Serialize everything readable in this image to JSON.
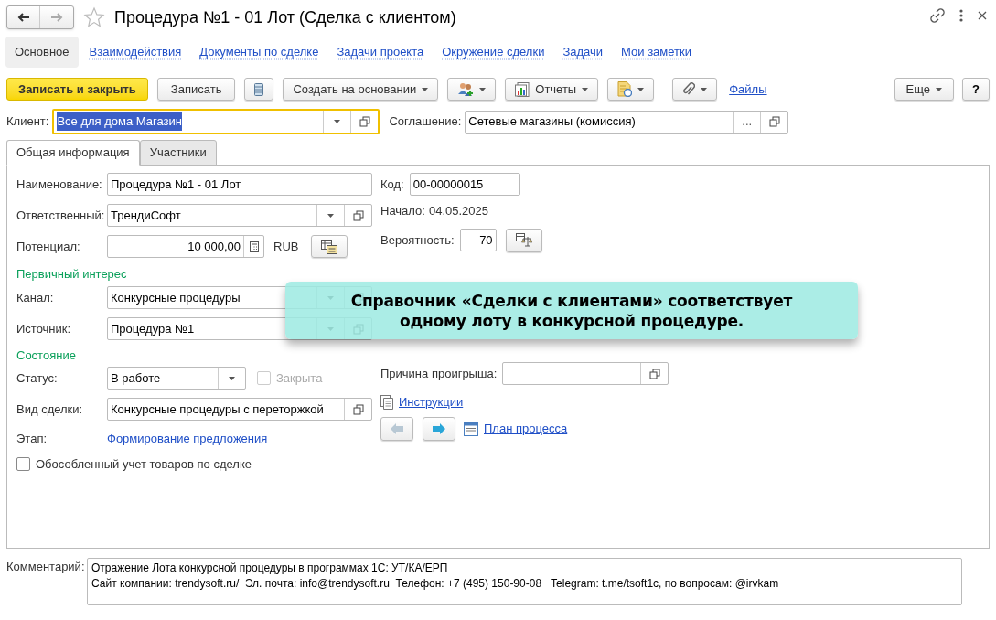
{
  "window": {
    "title": "Процедура №1 - 01 Лот (Сделка с клиентом)",
    "back_disabled": false,
    "forward_disabled": true
  },
  "nav_tabs": [
    {
      "label": "Основное",
      "selected": true
    },
    {
      "label": "Взаимодействия",
      "selected": false
    },
    {
      "label": "Документы по сделке",
      "selected": false
    },
    {
      "label": "Задачи проекта",
      "selected": false
    },
    {
      "label": "Окружение сделки",
      "selected": false
    },
    {
      "label": "Задачи",
      "selected": false
    },
    {
      "label": "Мои заметки",
      "selected": false
    }
  ],
  "toolbar": {
    "save_and_close": "Записать и закрыть",
    "save": "Записать",
    "create_based_on": "Создать на основании",
    "reports": "Отчеты",
    "files": "Файлы",
    "more": "Еще",
    "help": "?"
  },
  "client": {
    "label": "Клиент:",
    "value": "Все для дома Магазин"
  },
  "agreement": {
    "label": "Соглашение:",
    "value": "Сетевые магазины (комиссия)",
    "choose": "..."
  },
  "form_tabs": [
    {
      "label": "Общая информация",
      "selected": true
    },
    {
      "label": "Участники",
      "selected": false
    }
  ],
  "fields": {
    "name": {
      "label": "Наименование:",
      "value": "Процедура №1 - 01 Лот"
    },
    "code": {
      "label": "Код:",
      "value": "00-00000015"
    },
    "responsible": {
      "label": "Ответственный:",
      "value": "ТрендиСофт"
    },
    "start": {
      "label": "Начало:",
      "value": "04.05.2025"
    },
    "potential": {
      "label": "Потенциал:",
      "value": "10 000,00",
      "currency": "RUB"
    },
    "probability": {
      "label": "Вероятность:",
      "value": "70"
    },
    "channel": {
      "label": "Канал:",
      "value": "Конкурсные процедуры"
    },
    "source": {
      "label": "Источник:",
      "value": "Процедура №1"
    },
    "status": {
      "label": "Статус:",
      "value": "В работе"
    },
    "closed": {
      "label": "Закрыта",
      "checked": false,
      "disabled": true
    },
    "loss_reason": {
      "label": "Причина проигрыша:"
    },
    "deal_type": {
      "label": "Вид сделки:",
      "value": "Конкурсные процедуры с переторжкой"
    },
    "instructions": "Инструкции",
    "stage": {
      "label": "Этап:",
      "value": "Формирование предложения"
    },
    "prev_disabled": true,
    "next_disabled": false,
    "process_plan": "План процесса",
    "separate": {
      "label": "Обособленный учет товаров по сделке",
      "checked": false,
      "disabled": false
    }
  },
  "sections": {
    "primary_interest": "Первичный интерес",
    "state": "Состояние"
  },
  "comment": {
    "label": "Комментарий:",
    "lines": [
      "Отражение Лота конкурсной процедуры в программах 1С: УТ/КА/ЕРП",
      "Сайт компании: trendysoft.ru/  Эл. почта: info@trendysoft.ru  Телефон: +7 (495) 150-90-08   Telegram: t.me/tsoft1c, по вопросам: @irvkam"
    ]
  },
  "callout": {
    "lines": [
      "Справочник «Сделки с клиентами» соответствует",
      "одному лоту в конкурсной процедуре."
    ]
  }
}
